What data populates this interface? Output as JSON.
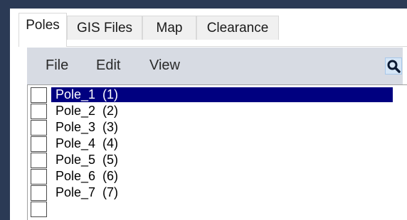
{
  "tabs": [
    {
      "label": "Poles",
      "active": true
    },
    {
      "label": "GIS Files",
      "active": false
    },
    {
      "label": "Map",
      "active": false
    },
    {
      "label": "Clearance",
      "active": false
    }
  ],
  "menu": {
    "file": "File",
    "edit": "Edit",
    "view": "View",
    "search_icon": "search-icon"
  },
  "colors": {
    "selection": "#000080",
    "menubar": "#d7dbe3",
    "window_border": "#2b3a55"
  },
  "poles": [
    {
      "label": "Pole_1  (1)",
      "checked": false,
      "selected": true
    },
    {
      "label": "Pole_2  (2)",
      "checked": false,
      "selected": false
    },
    {
      "label": "Pole_3  (3)",
      "checked": false,
      "selected": false
    },
    {
      "label": "Pole_4  (4)",
      "checked": false,
      "selected": false
    },
    {
      "label": "Pole_5  (5)",
      "checked": false,
      "selected": false
    },
    {
      "label": "Pole_6  (6)",
      "checked": false,
      "selected": false
    },
    {
      "label": "Pole_7  (7)",
      "checked": false,
      "selected": false
    }
  ]
}
